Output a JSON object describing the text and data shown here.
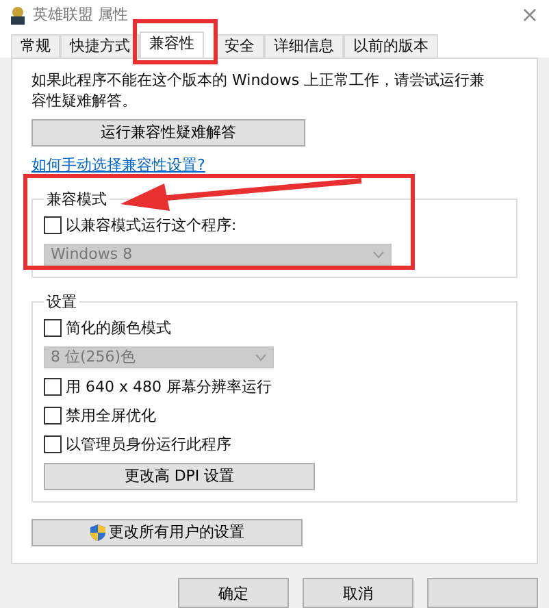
{
  "window": {
    "title": "英雄联盟 属性",
    "close": "×"
  },
  "tabs": [
    {
      "label": "常规",
      "selected": false
    },
    {
      "label": "快捷方式",
      "selected": false
    },
    {
      "label": "兼容性",
      "selected": true
    },
    {
      "label": "安全",
      "selected": false
    },
    {
      "label": "详细信息",
      "selected": false
    },
    {
      "label": "以前的版本",
      "selected": false
    }
  ],
  "intro": "如果此程序不能在这个版本的 Windows 上正常工作，请尝试运行兼容性疑难解答。",
  "troubleshoot_button": "运行兼容性疑难解答",
  "help_link": "如何手动选择兼容性设置?",
  "compat_mode": {
    "title": "兼容模式",
    "checkbox": {
      "label": "以兼容模式运行这个程序:",
      "checked": false
    },
    "dropdown": {
      "value": "Windows 8",
      "disabled": true
    }
  },
  "settings": {
    "title": "设置",
    "items": [
      {
        "kind": "checkbox",
        "label": "简化的颜色模式",
        "checked": false
      },
      {
        "kind": "dropdown",
        "value": "8 位(256)色",
        "disabled": true
      },
      {
        "kind": "checkbox",
        "label": "用 640 x 480 屏幕分辨率运行",
        "checked": false
      },
      {
        "kind": "checkbox",
        "label": "禁用全屏优化",
        "checked": false
      },
      {
        "kind": "checkbox",
        "label": "以管理员身份运行此程序",
        "checked": false
      },
      {
        "kind": "button",
        "label": "更改高 DPI 设置"
      }
    ]
  },
  "all_users_button": "更改所有用户的设置",
  "dialog_buttons": [
    "确定",
    "取消"
  ]
}
